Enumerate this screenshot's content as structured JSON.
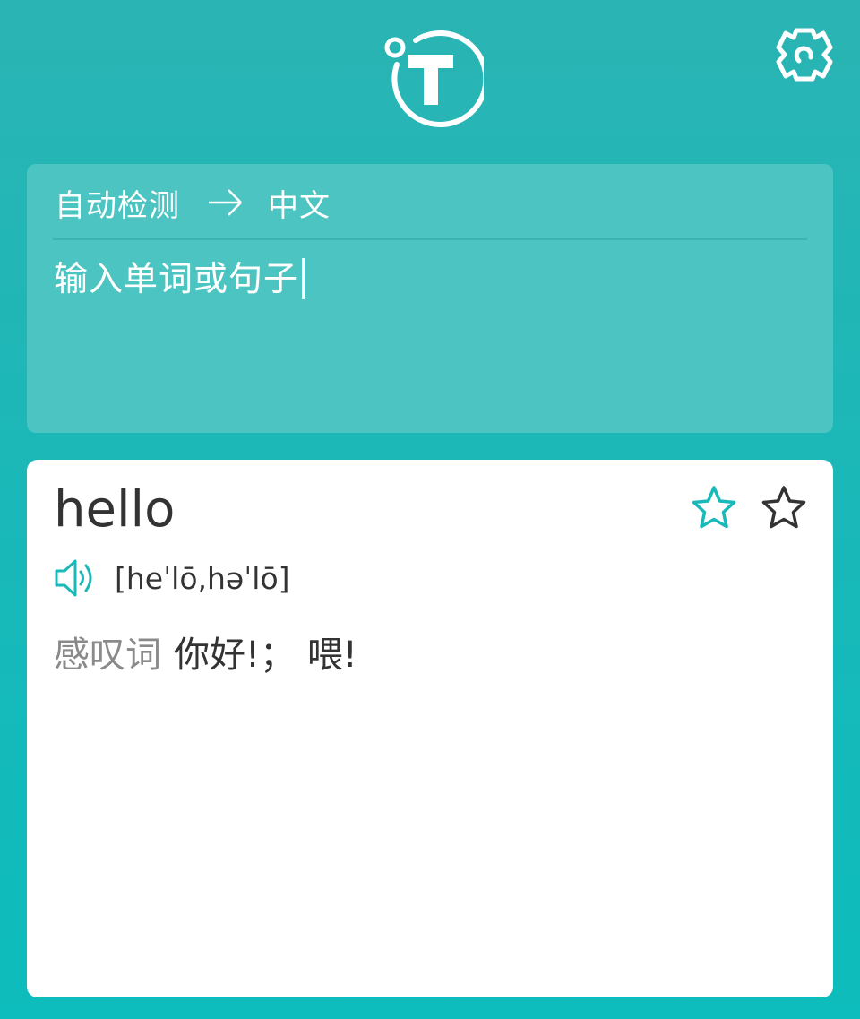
{
  "app": {
    "logo_icon": "t-planet-logo-icon",
    "settings_icon": "gear-icon"
  },
  "colors": {
    "background_top": "#2bb4b4",
    "background_bottom": "#0dbcbc",
    "input_panel": "#4cc4c2",
    "accent": "#19b9b9",
    "card": "#ffffff"
  },
  "translator": {
    "source_lang": "自动检测",
    "arrow_icon": "arrow-right-icon",
    "target_lang": "中文",
    "input_text": "输入单词或句子"
  },
  "result": {
    "word": "hello",
    "phonetic": "[heˈlō,həˈlō]",
    "speaker_icon": "speaker-icon",
    "star_icons": [
      "star-outline-teal-icon",
      "star-outline-dark-icon"
    ],
    "part_of_speech": "感叹词",
    "meaning": "你好!； 喂!"
  }
}
